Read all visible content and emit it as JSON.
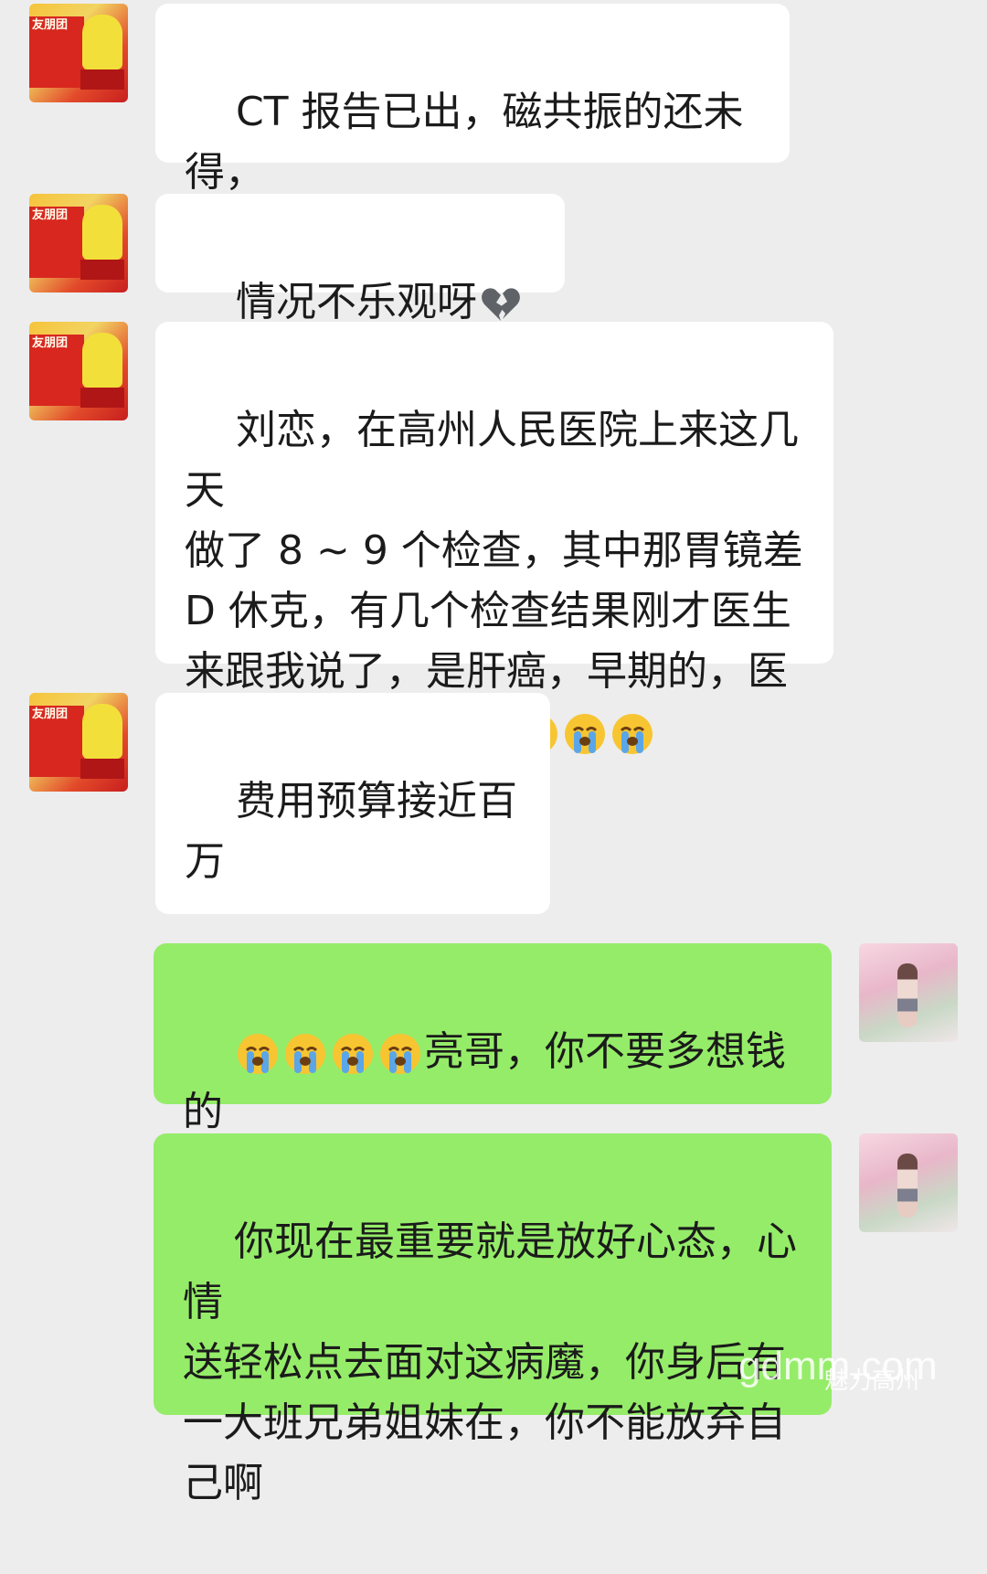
{
  "messages": [
    {
      "side": "in",
      "text": "CT 报告已出，磁共振的还未得，\n应该明天吧",
      "emojis": []
    },
    {
      "side": "in",
      "text": "情况不乐观呀",
      "emojis": [
        "broken-heart",
        "broken-heart"
      ]
    },
    {
      "side": "in",
      "text": "刘恋，在高州人民医院上来这几天\n做了 8 ~ 9 个检查，其中那胃镜差\nD 休克，有几个检查结果刚才医生\n来跟我说了，是肝癌，早期的，医\n生叫我尽早换肝",
      "emojis": [
        "loudly-crying",
        "loudly-crying",
        "loudly-crying",
        "loudly-crying"
      ]
    },
    {
      "side": "in",
      "text": "费用预算接近百万\n\n我值吗？真的心碎",
      "emojis": []
    },
    {
      "side": "out",
      "prefix_emojis": [
        "loudly-crying",
        "loudly-crying",
        "loudly-crying",
        "loudly-crying"
      ],
      "text": "亮哥，你不要多想钱的\n事，我们来帮你想办法"
    },
    {
      "side": "out",
      "text": "你现在最重要就是放好心态，心情\n送轻松点去面对这病魔，你身后有\n一大班兄弟姐妹在，你不能放弃自\n己啊",
      "emojis": []
    }
  ],
  "avatars": {
    "sender_banner": "友朋团",
    "sender_icon": "avatar-sender-yellow-shirt",
    "self_icon": "avatar-self-flower-garden"
  },
  "watermark": {
    "site": "gdmm.com",
    "account": "魅力高州"
  }
}
